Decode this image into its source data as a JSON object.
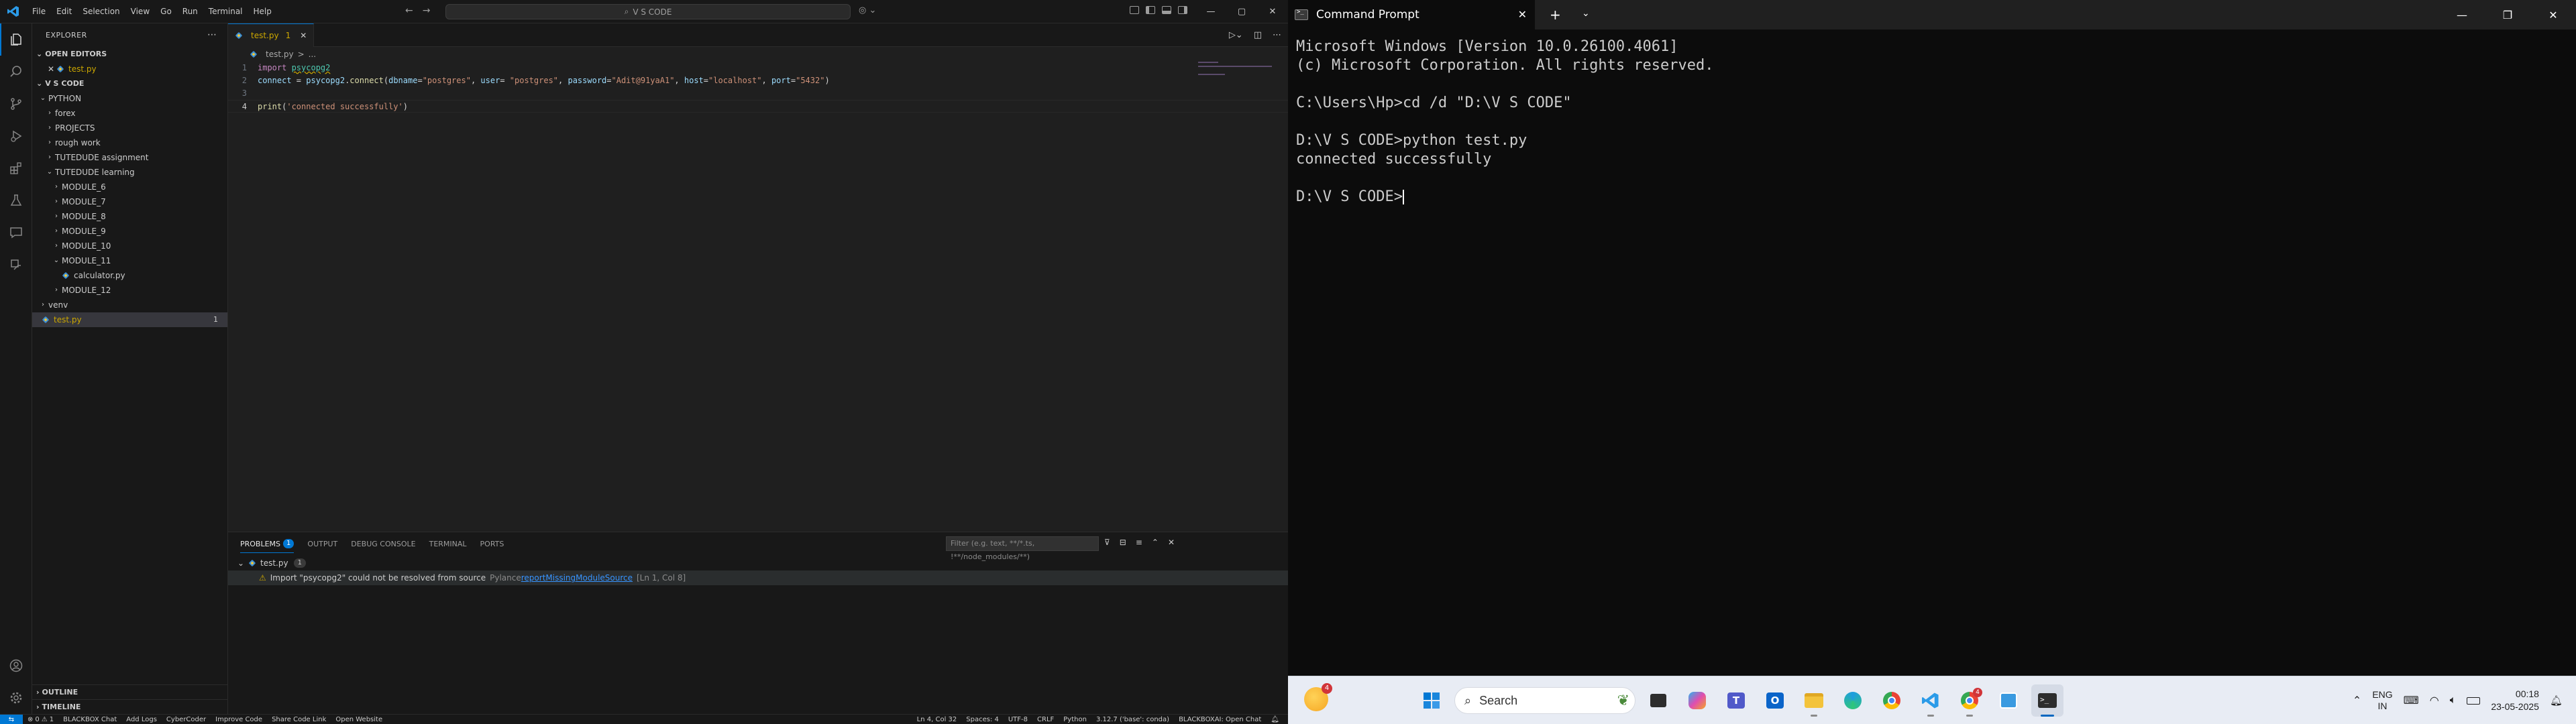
{
  "vscode": {
    "menu": [
      "File",
      "Edit",
      "Selection",
      "View",
      "Go",
      "Run",
      "Terminal",
      "Help"
    ],
    "command_center": "V S CODE",
    "explorer_title": "EXPLORER",
    "open_editors_label": "OPEN EDITORS",
    "open_editor_file": "test.py",
    "workspace_label": "V S CODE",
    "tree": [
      {
        "label": "PYTHON",
        "depth": 0,
        "kind": "folder-open"
      },
      {
        "label": "forex",
        "depth": 1,
        "kind": "folder"
      },
      {
        "label": "PROJECTS",
        "depth": 1,
        "kind": "folder"
      },
      {
        "label": "rough work",
        "depth": 1,
        "kind": "folder"
      },
      {
        "label": "TUTEDUDE assignment",
        "depth": 1,
        "kind": "folder"
      },
      {
        "label": "TUTEDUDE learning",
        "depth": 1,
        "kind": "folder-open"
      },
      {
        "label": "MODULE_6",
        "depth": 2,
        "kind": "folder"
      },
      {
        "label": "MODULE_7",
        "depth": 2,
        "kind": "folder"
      },
      {
        "label": "MODULE_8",
        "depth": 2,
        "kind": "folder"
      },
      {
        "label": "MODULE_9",
        "depth": 2,
        "kind": "folder"
      },
      {
        "label": "MODULE_10",
        "depth": 2,
        "kind": "folder"
      },
      {
        "label": "MODULE_11",
        "depth": 2,
        "kind": "folder-open"
      },
      {
        "label": "calculator.py",
        "depth": 3,
        "kind": "py"
      },
      {
        "label": "MODULE_12",
        "depth": 2,
        "kind": "folder"
      },
      {
        "label": "venv",
        "depth": 0,
        "kind": "folder"
      },
      {
        "label": "test.py",
        "depth": 0,
        "kind": "py-warn",
        "badge": "1"
      }
    ],
    "outline_label": "OUTLINE",
    "timeline_label": "TIMELINE",
    "tab": {
      "name": "test.py",
      "problems": "1"
    },
    "breadcrumb": [
      "test.py",
      ">",
      "..."
    ],
    "code": [
      {
        "n": "1",
        "tokens": [
          [
            "kw",
            "import "
          ],
          [
            "mod",
            "psycopg2"
          ]
        ]
      },
      {
        "n": "2",
        "tokens": [
          [
            "var",
            "connect"
          ],
          [
            "pl",
            " = "
          ],
          [
            "var",
            "psycopg2"
          ],
          [
            "pl",
            "."
          ],
          [
            "fn",
            "connect"
          ],
          [
            "pl",
            "("
          ],
          [
            "var",
            "dbname"
          ],
          [
            "pl",
            "="
          ],
          [
            "str",
            "\"postgres\""
          ],
          [
            "pl",
            ", "
          ],
          [
            "var",
            "user"
          ],
          [
            "pl",
            "= "
          ],
          [
            "str",
            "\"postgres\""
          ],
          [
            "pl",
            ", "
          ],
          [
            "var",
            "password"
          ],
          [
            "pl",
            "="
          ],
          [
            "str",
            "\"Adit@91yaA1\""
          ],
          [
            "pl",
            ", "
          ],
          [
            "var",
            "host"
          ],
          [
            "pl",
            "="
          ],
          [
            "str",
            "\"localhost\""
          ],
          [
            "pl",
            ", "
          ],
          [
            "var",
            "port"
          ],
          [
            "pl",
            "="
          ],
          [
            "str",
            "\"5432\""
          ],
          [
            "pl",
            ")"
          ]
        ]
      },
      {
        "n": "3",
        "tokens": []
      },
      {
        "n": "4",
        "tokens": [
          [
            "fn",
            "print"
          ],
          [
            "pl",
            "("
          ],
          [
            "str",
            "'connected successfully'"
          ],
          [
            "pl",
            ")"
          ]
        ],
        "current": true
      }
    ],
    "panel": {
      "tabs": [
        "PROBLEMS",
        "OUTPUT",
        "DEBUG CONSOLE",
        "TERMINAL",
        "PORTS"
      ],
      "problems_count": "1",
      "filter_placeholder": "Filter (e.g. text, **/*.ts, !**/node_modules/**)",
      "file": "test.py",
      "file_count": "1",
      "message": "Import \"psycopg2\" could not be resolved from source",
      "source": "Pylance",
      "rule": "reportMissingModuleSource",
      "position": "[Ln 1, Col 8]"
    },
    "status": {
      "errors": "0",
      "warnings": "1",
      "items_left": [
        "BLACKBOX Chat",
        "Add Logs",
        "CyberCoder",
        "Improve Code",
        "Share Code Link",
        "Open Website"
      ],
      "items_right": [
        "Ln 4, Col 32",
        "Spaces: 4",
        "UTF-8",
        "CRLF",
        "Python",
        "3.12.7 ('base': conda)",
        "BLACKBOXAI: Open Chat"
      ]
    }
  },
  "cmd": {
    "title": "Command Prompt",
    "lines": [
      "Microsoft Windows [Version 10.0.26100.4061]",
      "(c) Microsoft Corporation. All rights reserved.",
      "",
      "C:\\Users\\Hp>cd /d \"D:\\V S CODE\"",
      "",
      "D:\\V S CODE>python test.py",
      "connected successfully",
      ""
    ],
    "prompt": "D:\\V S CODE>"
  },
  "taskbar": {
    "weather_badge": "4",
    "search_label": "Search",
    "lang_top": "ENG",
    "lang_bottom": "IN",
    "time": "00:18",
    "date": "23-05-2025",
    "chrome_badge": "4",
    "apps": [
      "start-icon",
      "search",
      "frog-icon",
      "file-explorer-dark-icon",
      "copilot-icon",
      "teams-icon",
      "outlook-icon",
      "folder-icon",
      "edge-icon",
      "chrome-icon",
      "vscode-icon",
      "chrome-profile-icon",
      "paint-icon",
      "terminal-icon"
    ]
  }
}
